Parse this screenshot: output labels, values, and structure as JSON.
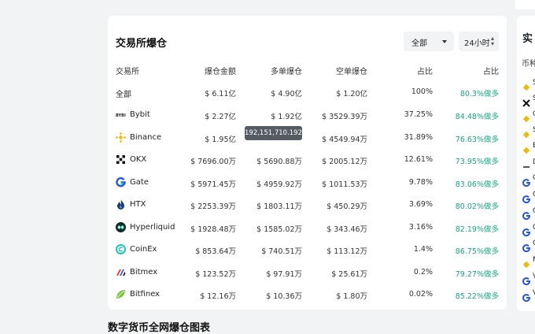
{
  "card": {
    "title": "交易所爆仓",
    "filter_exchange": "全部",
    "filter_time": "24小时",
    "headers": [
      "交易所",
      "爆仓金额",
      "多单爆仓",
      "空单爆仓",
      "占比",
      "占比"
    ],
    "rows": [
      {
        "exchange": "全部",
        "amount": "$ 6.11亿",
        "long": "$ 4.90亿",
        "short": "$ 1.20亿",
        "pct": "100%",
        "side": "80.3%做多"
      },
      {
        "exchange": "Bybit",
        "amount": "$ 2.27亿",
        "long": "$ 1.92亿",
        "short": "$ 3529.39万",
        "pct": "37.25%",
        "side": "84.48%做多"
      },
      {
        "exchange": "Binance",
        "amount": "$ 1.95亿",
        "long": "",
        "short": "$ 4549.94万",
        "pct": "31.89%",
        "side": "76.63%做多"
      },
      {
        "exchange": "OKX",
        "amount": "$ 7696.00万",
        "long": "$ 5690.88万",
        "short": "$ 2005.12万",
        "pct": "12.61%",
        "side": "73.95%做多"
      },
      {
        "exchange": "Gate",
        "amount": "$ 5971.45万",
        "long": "$ 4959.92万",
        "short": "$ 1011.53万",
        "pct": "9.78%",
        "side": "83.06%做多"
      },
      {
        "exchange": "HTX",
        "amount": "$ 2253.39万",
        "long": "$ 1803.11万",
        "short": "$ 450.29万",
        "pct": "3.69%",
        "side": "80.02%做多"
      },
      {
        "exchange": "Hyperliquid",
        "amount": "$ 1928.48万",
        "long": "$ 1585.02万",
        "short": "$ 343.46万",
        "pct": "3.16%",
        "side": "82.19%做多"
      },
      {
        "exchange": "CoinEx",
        "amount": "$ 853.64万",
        "long": "$ 740.51万",
        "short": "$ 113.12万",
        "pct": "1.4%",
        "side": "86.75%做多"
      },
      {
        "exchange": "Bitmex",
        "amount": "$ 123.52万",
        "long": "$ 97.91万",
        "short": "$ 25.61万",
        "pct": "0.2%",
        "side": "79.27%做多"
      },
      {
        "exchange": "Bitfinex",
        "amount": "$ 12.16万",
        "long": "$ 10.36万",
        "short": "$ 1.80万",
        "pct": "0.02%",
        "side": "85.22%做多"
      }
    ],
    "tooltip": "192,151,710.192"
  },
  "bottom_title": "数字货币全网爆仓图表",
  "right_panel": {
    "title": "实",
    "subtitle": "币种",
    "letters": [
      "S",
      "S",
      "C",
      "S",
      "E",
      "D",
      "C",
      "C",
      "C",
      "C",
      "C",
      "N",
      "V",
      "V"
    ]
  },
  "colors": {
    "accent_green": "#16a77f",
    "binance": "#f0b90b",
    "gate": "#2354e6"
  }
}
